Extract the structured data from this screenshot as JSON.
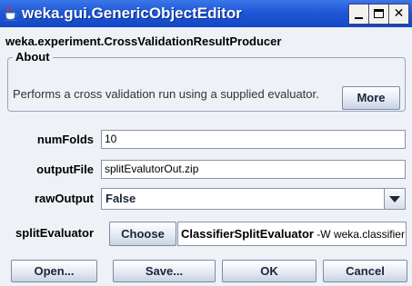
{
  "window": {
    "title": "weka.gui.GenericObjectEditor",
    "icon": "java-coffee-icon"
  },
  "editor": {
    "class_name": "weka.experiment.CrossValidationResultProducer",
    "about_title": "About",
    "about_text": "Performs a cross validation run using a supplied evaluator.",
    "more_label": "More"
  },
  "properties": {
    "numFolds": {
      "label": "numFolds",
      "value": "10"
    },
    "outputFile": {
      "label": "outputFile",
      "value": "splitEvalutorOut.zip"
    },
    "rawOutput": {
      "label": "rawOutput",
      "value": "False"
    },
    "splitEvaluator": {
      "label": "splitEvaluator",
      "choose_label": "Choose",
      "class_name": "ClassifierSplitEvaluator",
      "options": " -W weka.classifier"
    }
  },
  "buttons": {
    "open": "Open...",
    "save": "Save...",
    "ok": "OK",
    "cancel": "Cancel"
  }
}
